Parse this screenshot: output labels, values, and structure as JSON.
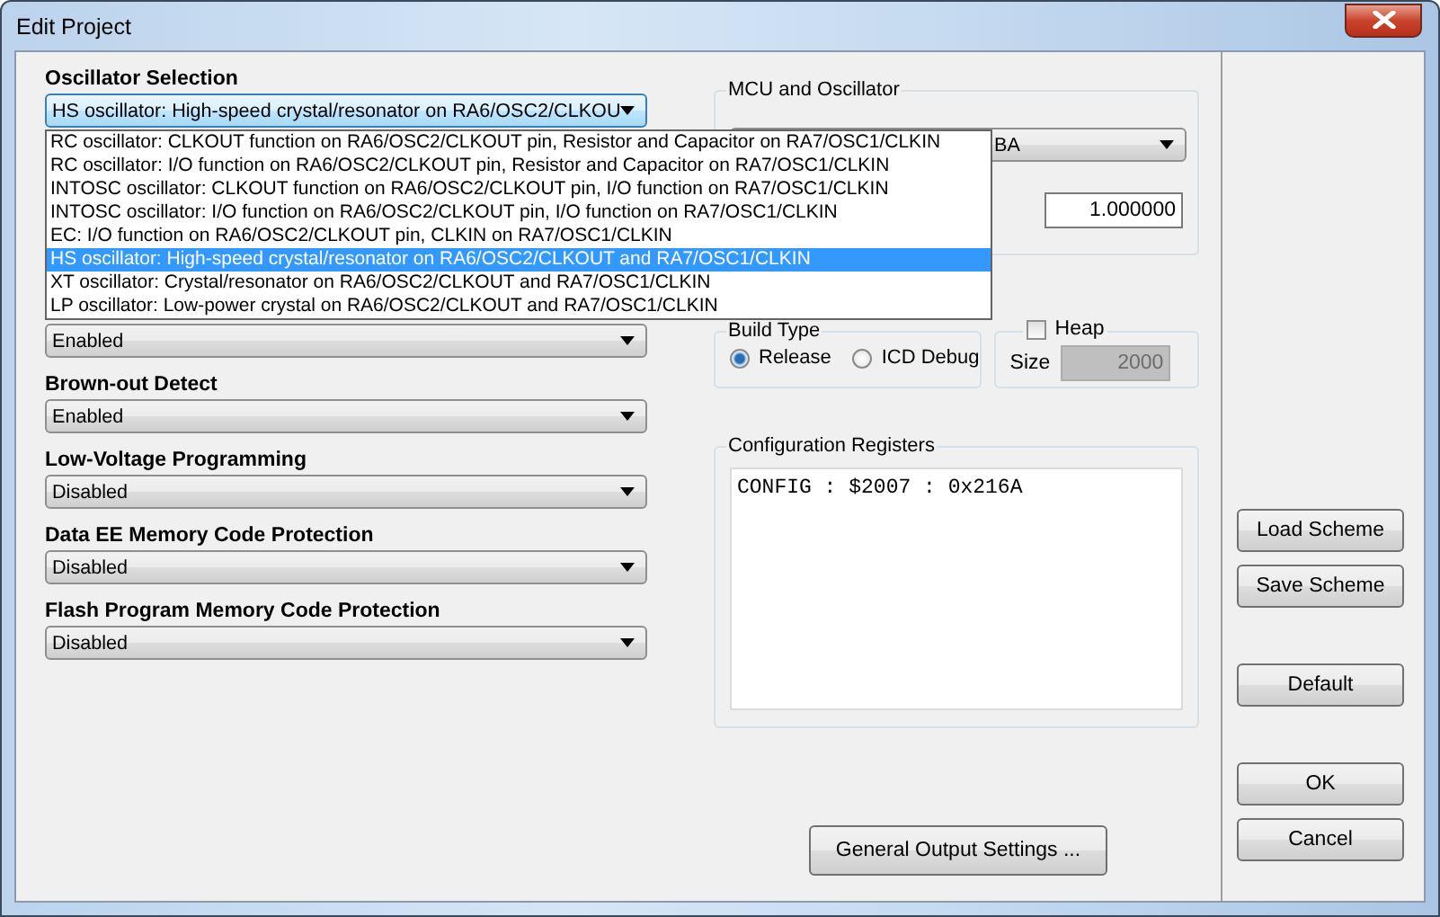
{
  "window": {
    "title": "Edit Project"
  },
  "left_fields": [
    {
      "label": "Oscillator Selection",
      "value": "HS oscillator: High-speed crystal/resonator on RA6/OSC2/CLKOU",
      "focused": true,
      "expanded": true,
      "options": [
        {
          "text": "RC oscillator: CLKOUT function on RA6/OSC2/CLKOUT pin, Resistor and Capacitor on RA7/OSC1/CLKIN",
          "selected": false
        },
        {
          "text": "RC oscillator: I/O function on RA6/OSC2/CLKOUT pin, Resistor and Capacitor on RA7/OSC1/CLKIN",
          "selected": false
        },
        {
          "text": "INTOSC oscillator: CLKOUT function on RA6/OSC2/CLKOUT pin, I/O function on RA7/OSC1/CLKIN",
          "selected": false
        },
        {
          "text": "INTOSC oscillator: I/O function on RA6/OSC2/CLKOUT pin, I/O function on RA7/OSC1/CLKIN",
          "selected": false
        },
        {
          "text": "EC: I/O function on RA6/OSC2/CLKOUT pin, CLKIN on RA7/OSC1/CLKIN",
          "selected": false
        },
        {
          "text": "HS oscillator: High-speed crystal/resonator on RA6/OSC2/CLKOUT and RA7/OSC1/CLKIN",
          "selected": true
        },
        {
          "text": "XT oscillator: Crystal/resonator on RA6/OSC2/CLKOUT and RA7/OSC1/CLKIN",
          "selected": false
        },
        {
          "text": "LP oscillator: Low-power crystal on RA6/OSC2/CLKOUT and RA7/OSC1/CLKIN",
          "selected": false
        }
      ]
    },
    {
      "value": "Enabled"
    },
    {
      "label": "Brown-out Detect",
      "value": "Enabled"
    },
    {
      "label": "Low-Voltage Programming",
      "value": "Disabled"
    },
    {
      "label": "Data EE Memory Code Protection",
      "value": "Disabled"
    },
    {
      "label": "Flash Program Memory Code Protection",
      "value": "Disabled"
    }
  ],
  "mcu_group": {
    "title": "MCU and Oscillator",
    "select_value": "BA",
    "frequency": "1.000000"
  },
  "build_type": {
    "title": "Build Type",
    "options": [
      {
        "label": "Release",
        "selected": true
      },
      {
        "label": "ICD Debug",
        "selected": false
      }
    ]
  },
  "heap": {
    "label": "Heap",
    "checked": false,
    "size_label": "Size",
    "size": "2000",
    "disabled": true
  },
  "config": {
    "title": "Configuration Registers",
    "text": "CONFIG : $2007 : 0x216A"
  },
  "general_output_button": "General Output Settings ...",
  "side_button_groups": [
    [
      "Load Scheme",
      "Save Scheme"
    ],
    [
      "Default"
    ],
    [
      "OK",
      "Cancel"
    ]
  ]
}
